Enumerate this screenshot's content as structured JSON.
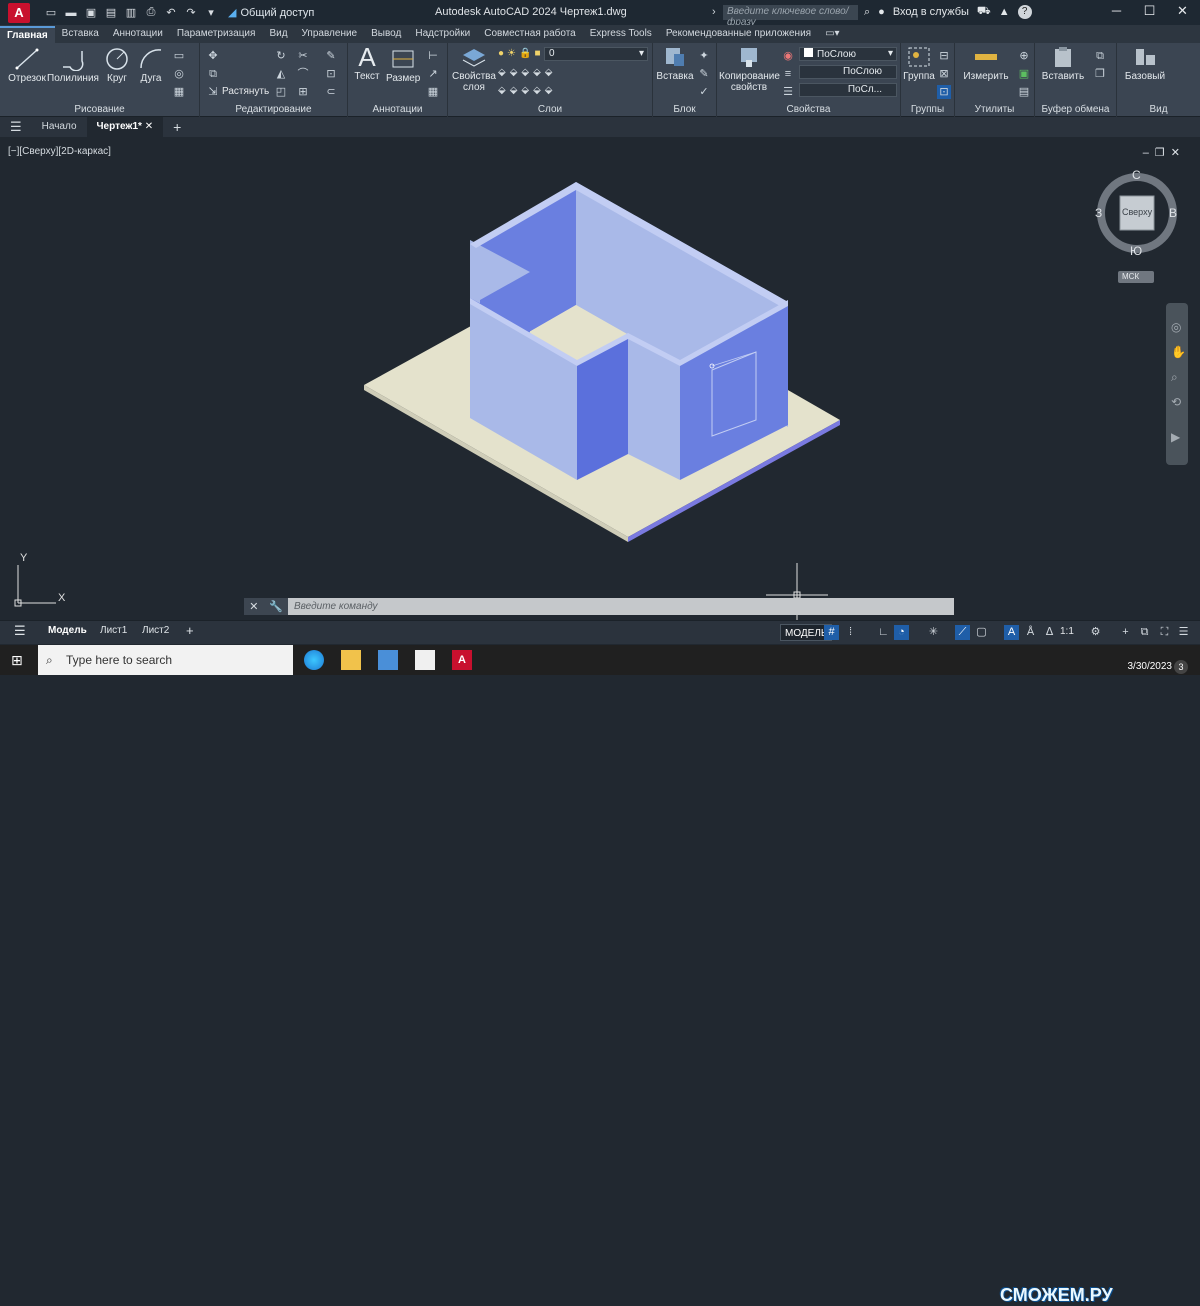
{
  "titlebar": {
    "logo": "A",
    "share_label": "Общий доступ",
    "title": "Autodesk AutoCAD 2024    Чертеж1.dwg",
    "search_placeholder": "Введите ключевое слово/фразу",
    "signin": "Вход в службы"
  },
  "tabs": [
    "Главная",
    "Вставка",
    "Аннотации",
    "Параметризация",
    "Вид",
    "Управление",
    "Вывод",
    "Надстройки",
    "Совместная работа",
    "Express Tools",
    "Рекомендованные приложения"
  ],
  "ribbon": {
    "draw": {
      "label": "Рисование",
      "tools": [
        "Отрезок",
        "Полилиния",
        "Круг",
        "Дуга"
      ]
    },
    "modify": {
      "label": "Редактирование",
      "stretch": "Растянуть"
    },
    "annot": {
      "label": "Аннотации",
      "text": "Текст",
      "dim": "Размер"
    },
    "layers": {
      "label": "Слои",
      "props": "Свойства\nслоя",
      "current": "0"
    },
    "block": {
      "label": "Блок",
      "insert": "Вставка"
    },
    "props": {
      "label": "Свойства",
      "copy": "Копирование\nсвойств",
      "bylayer1": "ПоСлою",
      "bylayer2": "ПоСлою",
      "bylayer3": "ПоСл..."
    },
    "groups": {
      "label": "Группы",
      "group": "Группа"
    },
    "utils": {
      "label": "Утилиты",
      "measure": "Измерить"
    },
    "clipboard": {
      "label": "Буфер обмена",
      "paste": "Вставить"
    },
    "view": {
      "label": "Вид",
      "base": "Базовый"
    }
  },
  "filetabs": {
    "start": "Начало",
    "drawing": "Чертеж1*"
  },
  "viewport": {
    "label": "[−][Сверху][2D-каркас]",
    "viewcube_top": "Сверху",
    "compass": {
      "n": "С",
      "s": "Ю",
      "w": "З",
      "e": "В"
    },
    "ucs_label": "МСК",
    "axis_x": "X",
    "axis_y": "Y"
  },
  "cmd": {
    "placeholder": "Введите команду"
  },
  "status": {
    "layouts": [
      "Модель",
      "Лист1",
      "Лист2"
    ],
    "model": "МОДЕЛЬ",
    "scale": "1:1"
  },
  "taskbar": {
    "search": "Type here to search",
    "date": "3/30/2023",
    "notifications": "3"
  },
  "watermark": "СМОЖЕМ.РУ"
}
